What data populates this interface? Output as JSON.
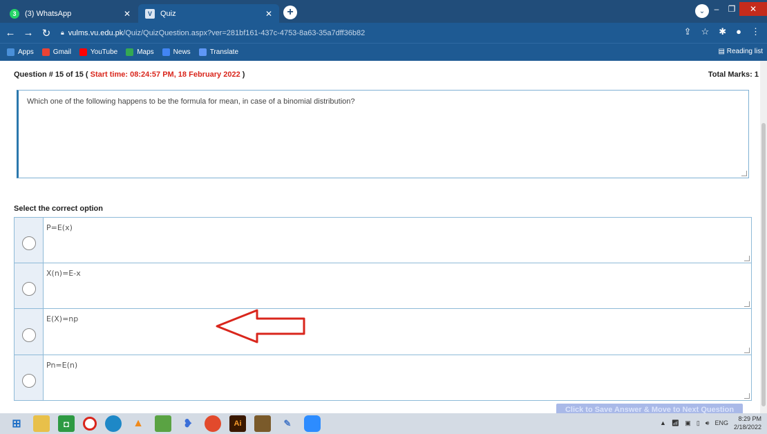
{
  "browser": {
    "tabs": [
      {
        "label": "(3) WhatsApp",
        "badge": "3"
      },
      {
        "label": "Quiz"
      }
    ],
    "url_host": "vulms.vu.edu.pk",
    "url_path": "/Quiz/QuizQuestion.aspx?ver=281bf161-437c-4753-8a63-35a7dff36b82",
    "bookmarks": [
      "Apps",
      "Gmail",
      "YouTube",
      "Maps",
      "News",
      "Translate"
    ],
    "reading_list": "Reading list"
  },
  "quiz": {
    "question_label": "Question # 15 of 15 (",
    "start_time": "Start time: 08:24:57 PM, 18 February 2022",
    "question_close": ")",
    "total_marks": "Total Marks: 1",
    "question_text": "Which one of the following happens to be the formula for mean, in case of a binomial distribution?",
    "select_label": "Select the correct option",
    "options": [
      "P=E(x)",
      "X(n)=E-x",
      "E(X)=np",
      "Pn=E(n)"
    ],
    "save_button": "Click to Save Answer & Move to Next Question"
  },
  "taskbar": {
    "language": "ENG",
    "time": "8:29 PM",
    "date": "2/18/2022"
  },
  "colors": {
    "tabbar": "#214d7a",
    "toolbar": "#1e5a93",
    "highlight_red": "#d9261c",
    "option_border": "#8ebad8"
  }
}
